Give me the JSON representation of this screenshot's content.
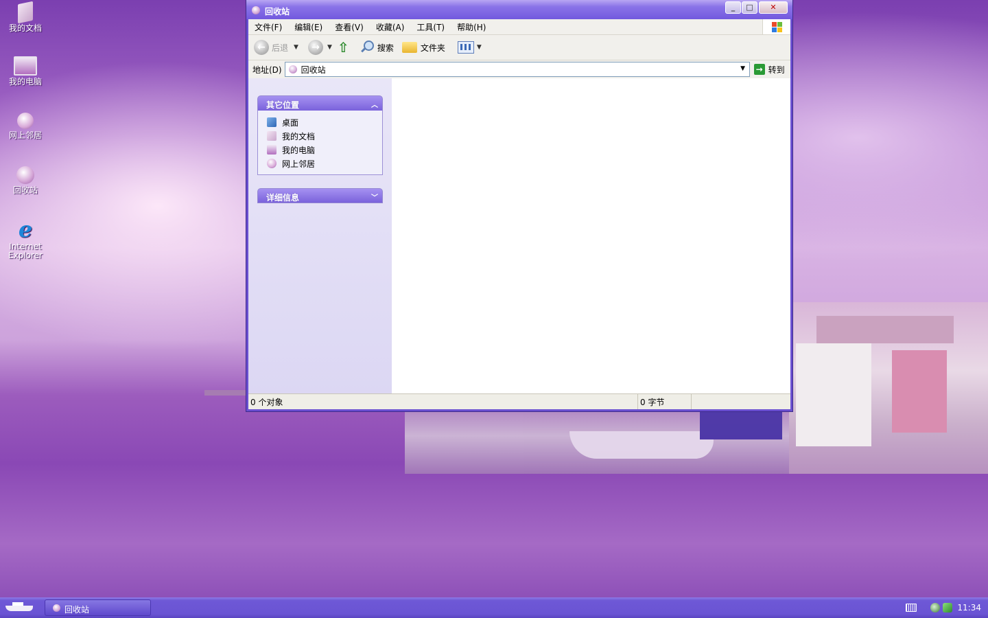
{
  "desktop": {
    "icons": [
      {
        "label": "我的文档"
      },
      {
        "label": "我的电脑"
      },
      {
        "label": "网上邻居"
      },
      {
        "label": "回收站"
      },
      {
        "label_line1": "Internet",
        "label_line2": "Explorer"
      }
    ]
  },
  "window": {
    "title": "回收站",
    "buttons": {
      "minimize": "_",
      "maximize": "□",
      "close": "✕"
    },
    "menu": [
      "文件(F)",
      "编辑(E)",
      "查看(V)",
      "收藏(A)",
      "工具(T)",
      "帮助(H)"
    ],
    "toolbar": {
      "back": "后退",
      "search": "搜索",
      "folders": "文件夹"
    },
    "address": {
      "label": "地址(D)",
      "value": "回收站",
      "go": "转到"
    },
    "tasks": {
      "other_places": {
        "title": "其它位置",
        "links": [
          "桌面",
          "我的文档",
          "我的电脑",
          "网上邻居"
        ]
      },
      "details": {
        "title": "详细信息"
      }
    },
    "status": {
      "objects": "0 个对象",
      "size": "0 字节"
    }
  },
  "taskbar": {
    "task_label": "回收站",
    "clock": "11:34"
  },
  "colors": {
    "title_bar": "#7259de",
    "taskbar": "#6a54d3",
    "go_arrow": "#2a9a35"
  }
}
